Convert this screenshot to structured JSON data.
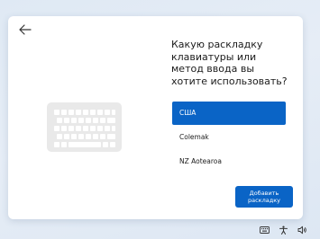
{
  "window": {
    "back_button_icon": "arrow-left-icon"
  },
  "question": {
    "title": "Какую раскладку клавиатуры или метод ввода вы хотите использовать?"
  },
  "layouts": [
    {
      "label": "США",
      "selected": true
    },
    {
      "label": "Colemak",
      "selected": false
    },
    {
      "label": "NZ Aotearoa",
      "selected": false
    }
  ],
  "add_button": {
    "line1": "Добавить",
    "line2": "раскладку"
  },
  "tray": {
    "icons": [
      "keyboard-icon",
      "accessibility-icon",
      "volume-icon"
    ]
  },
  "colors": {
    "accent": "#0a64c6",
    "background": "#e3ebf5"
  }
}
